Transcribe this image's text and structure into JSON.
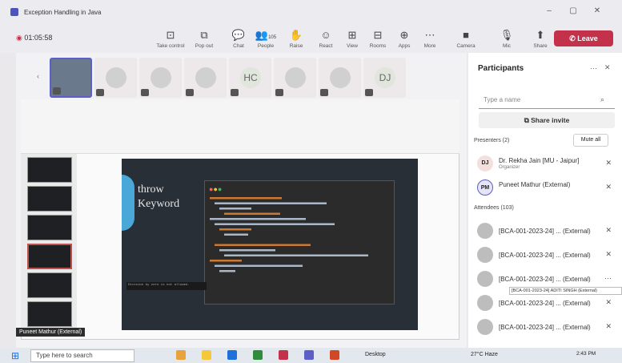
{
  "window": {
    "title": "Exception Handling in Java",
    "minimize": "–",
    "restore": "▢",
    "close": "✕"
  },
  "meeting": {
    "timer": "01:05:58"
  },
  "toolbar": {
    "items": [
      {
        "label": "Take control",
        "icon": "take-control"
      },
      {
        "label": "Pop out",
        "icon": "pop-out"
      },
      {
        "label": "Chat",
        "icon": "chat"
      },
      {
        "label": "People",
        "icon": "people",
        "count": "105"
      },
      {
        "label": "Raise",
        "icon": "raise-hand"
      },
      {
        "label": "React",
        "icon": "react"
      },
      {
        "label": "View",
        "icon": "view"
      },
      {
        "label": "Rooms",
        "icon": "rooms"
      },
      {
        "label": "Apps",
        "icon": "apps"
      },
      {
        "label": "More",
        "icon": "more"
      },
      {
        "label": "Camera",
        "icon": "camera"
      },
      {
        "label": "Mic",
        "icon": "mic"
      },
      {
        "label": "Share",
        "icon": "share"
      }
    ],
    "leave": "Leave"
  },
  "tiles": [
    {
      "initials": ""
    },
    {
      "initials": ""
    },
    {
      "initials": ""
    },
    {
      "initials": ""
    },
    {
      "initials": "HC"
    },
    {
      "initials": ""
    },
    {
      "initials": ""
    },
    {
      "initials": "DJ"
    }
  ],
  "share": {
    "slide_text": "throw\nKeyword",
    "code_output": "Division by zero is not allowed.",
    "presenter_tag": "Puneet Mathur (External)"
  },
  "panel": {
    "title": "Participants",
    "search_placeholder": "Type a name",
    "invite": "Share invite",
    "presenters_header": "Presenters (2)",
    "mute_all": "Mute all",
    "presenters": [
      {
        "initials": "DJ",
        "name": "Dr. Rekha Jain [MU - Jaipur]",
        "sub": "Organizer",
        "color": "#f3e0dc"
      },
      {
        "initials": "PM",
        "name": "Puneet Mathur (External)",
        "sub": "",
        "color": "#e6e4f7"
      }
    ],
    "attendees_header": "Attendees (103)",
    "attendees": [
      {
        "name": "[BCA-001-2023-24] ...",
        "tag": "(External)"
      },
      {
        "name": "[BCA-001-2023-24] ...",
        "tag": "(External)"
      },
      {
        "name": "[BCA-001-2023-24] ...",
        "tag": "(External)"
      },
      {
        "name": "[BCA-001-2023-24] ...",
        "tag": "(External)"
      },
      {
        "name": "[BCA-001-2023-24] ...",
        "tag": "(External)"
      }
    ],
    "tooltip": "[BCA-001-2023-24] ADITI SINGH (External)"
  },
  "taskbar": {
    "search": "Type here to search",
    "weather": "27°C Haze",
    "time": "2:43 PM",
    "desktop": "Desktop"
  }
}
